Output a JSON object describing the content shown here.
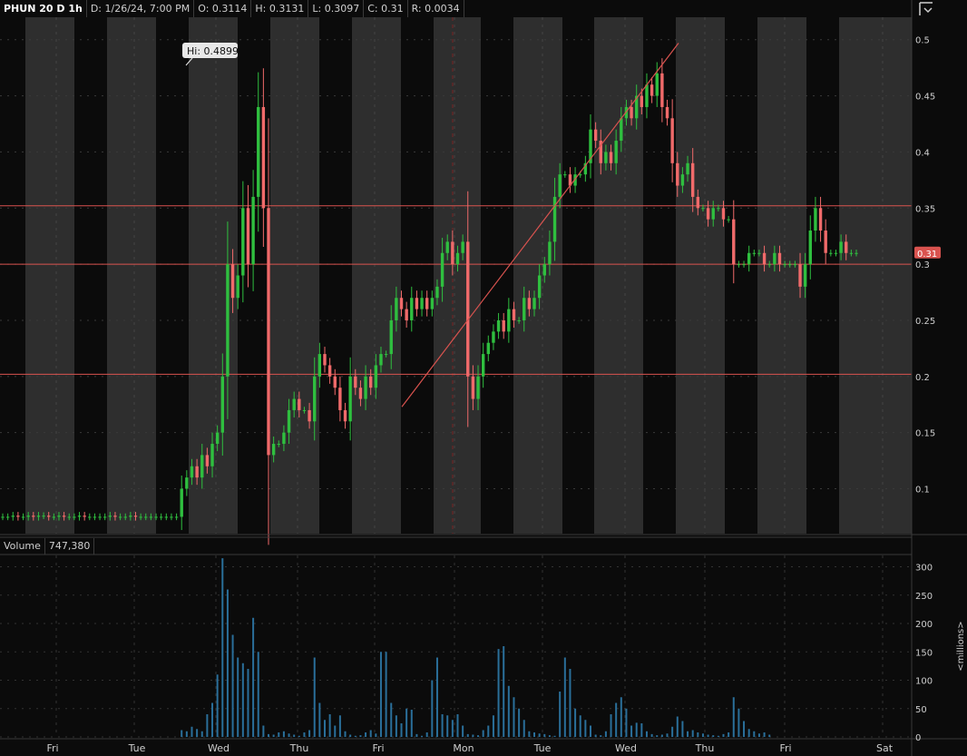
{
  "header": {
    "symbol": "PHUN 20 D 1h",
    "date": "D: 1/26/24, 7:00 PM",
    "open": "O: 0.3114",
    "high": "H: 0.3131",
    "low": "L: 0.3097",
    "close": "C: 0.31",
    "range": "R: 0.0034"
  },
  "volume_header": {
    "label": "Volume",
    "value": "747,380"
  },
  "colors": {
    "up": "#2fbf3f",
    "down": "#f06a6a",
    "volume": "#2a6f9a",
    "hline": "#d9534f",
    "band": "#2e2e2e"
  },
  "chart_data": [
    {
      "type": "candlestick",
      "title": "PHUN 20 D 1h",
      "x": [
        "Fri",
        "Tue",
        "Wed",
        "Thu",
        "Fri",
        "Mon",
        "Tue",
        "Wed",
        "Thu",
        "Fri",
        "Sat"
      ],
      "y_ticks": [
        "0.5",
        "0.45",
        "0.4",
        "0.35",
        "0.3",
        "0.25",
        "0.2",
        "0.15",
        "0.1"
      ],
      "ylim": [
        0.06,
        0.52
      ],
      "last_price": "0.31",
      "high_label": "Hi: 0.4899",
      "horizontal_lines": [
        0.352,
        0.3,
        0.202
      ],
      "trend_line": {
        "from": [
          0.173
        ],
        "to": [
          0.497
        ]
      },
      "closes": [
        0.075,
        0.075,
        0.076,
        0.075,
        0.075,
        0.076,
        0.075,
        0.076,
        0.076,
        0.075,
        0.075,
        0.076,
        0.075,
        0.075,
        0.075,
        0.076,
        0.075,
        0.075,
        0.075,
        0.075,
        0.075,
        0.076,
        0.075,
        0.075,
        0.075,
        0.076,
        0.075,
        0.075,
        0.075,
        0.075,
        0.075,
        0.075,
        0.075,
        0.075,
        0.075,
        0.1,
        0.11,
        0.12,
        0.11,
        0.13,
        0.12,
        0.14,
        0.15,
        0.2,
        0.3,
        0.27,
        0.29,
        0.35,
        0.3,
        0.36,
        0.44,
        0.35,
        0.13,
        0.14,
        0.14,
        0.15,
        0.17,
        0.18,
        0.17,
        0.17,
        0.16,
        0.2,
        0.22,
        0.21,
        0.2,
        0.19,
        0.17,
        0.16,
        0.2,
        0.19,
        0.18,
        0.2,
        0.19,
        0.21,
        0.22,
        0.22,
        0.25,
        0.27,
        0.26,
        0.25,
        0.27,
        0.26,
        0.27,
        0.26,
        0.27,
        0.28,
        0.31,
        0.32,
        0.3,
        0.31,
        0.32,
        0.2,
        0.18,
        0.2,
        0.22,
        0.23,
        0.24,
        0.25,
        0.24,
        0.26,
        0.25,
        0.25,
        0.27,
        0.26,
        0.27,
        0.29,
        0.3,
        0.32,
        0.36,
        0.38,
        0.38,
        0.37,
        0.38,
        0.38,
        0.39,
        0.42,
        0.41,
        0.39,
        0.4,
        0.39,
        0.41,
        0.43,
        0.44,
        0.43,
        0.45,
        0.44,
        0.46,
        0.45,
        0.47,
        0.44,
        0.43,
        0.39,
        0.37,
        0.38,
        0.39,
        0.36,
        0.35,
        0.35,
        0.34,
        0.35,
        0.35,
        0.34,
        0.34,
        0.3,
        0.3,
        0.3,
        0.31,
        0.31,
        0.31,
        0.3,
        0.3,
        0.31,
        0.3,
        0.3,
        0.3,
        0.3,
        0.28,
        0.3,
        0.33,
        0.35,
        0.33,
        0.31,
        0.31,
        0.31,
        0.32,
        0.31,
        0.31,
        0.31
      ],
      "volume": {
        "unit": "<millions>",
        "y_ticks": [
          "300",
          "250",
          "200",
          "150",
          "100",
          "50",
          "0"
        ],
        "ylim": [
          0,
          320
        ],
        "values": [
          0,
          0,
          0,
          0,
          0,
          0,
          0,
          0,
          0,
          0,
          0,
          0,
          0,
          0,
          0,
          0,
          0,
          0,
          0,
          0,
          0,
          0,
          0,
          0,
          0,
          0,
          0,
          0,
          0,
          0,
          0,
          0,
          0,
          0,
          0,
          12,
          10,
          18,
          14,
          10,
          40,
          60,
          110,
          315,
          260,
          180,
          140,
          130,
          120,
          210,
          150,
          20,
          5,
          4,
          8,
          10,
          6,
          4,
          2,
          8,
          12,
          140,
          60,
          30,
          40,
          20,
          38,
          10,
          4,
          2,
          3,
          8,
          12,
          6,
          150,
          150,
          60,
          38,
          24,
          50,
          48,
          5,
          2,
          8,
          100,
          140,
          40,
          38,
          30,
          40,
          20,
          5,
          4,
          3,
          12,
          20,
          38,
          155,
          160,
          90,
          70,
          50,
          30,
          10,
          8,
          6,
          5,
          3,
          2,
          80,
          140,
          120,
          50,
          38,
          30,
          20,
          4,
          3,
          10,
          40,
          60,
          70,
          50,
          20,
          25,
          24,
          10,
          5,
          3,
          4,
          6,
          18,
          36,
          28,
          10,
          12,
          8,
          6,
          4,
          3,
          2,
          5,
          8,
          70,
          50,
          28,
          14,
          10,
          6,
          8,
          4
        ]
      }
    }
  ]
}
